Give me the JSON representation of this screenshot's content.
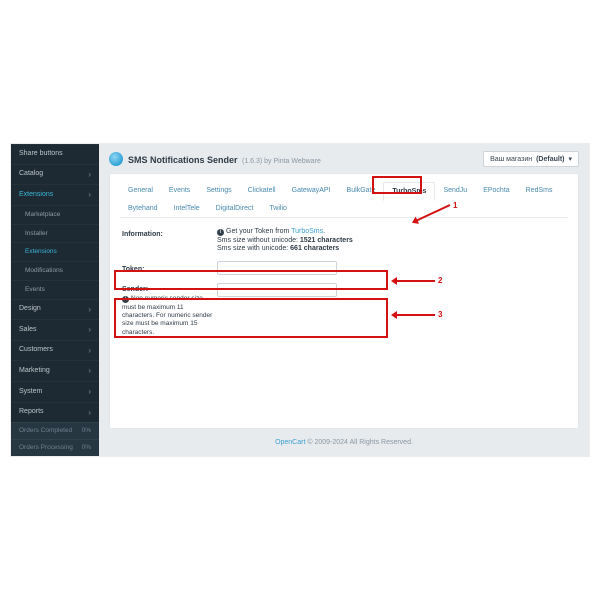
{
  "sidebar": {
    "items": [
      {
        "label": "Share buttons",
        "type": "item"
      },
      {
        "label": "Catalog",
        "type": "item",
        "chev": true
      },
      {
        "label": "Extensions",
        "type": "item",
        "chev": true,
        "active": true
      },
      {
        "label": "Marketplace",
        "type": "sub"
      },
      {
        "label": "Installer",
        "type": "sub"
      },
      {
        "label": "Extensions",
        "type": "sub",
        "selected": true
      },
      {
        "label": "Modifications",
        "type": "sub"
      },
      {
        "label": "Events",
        "type": "sub"
      },
      {
        "label": "Design",
        "type": "item",
        "chev": true
      },
      {
        "label": "Sales",
        "type": "item",
        "chev": true
      },
      {
        "label": "Customers",
        "type": "item",
        "chev": true
      },
      {
        "label": "Marketing",
        "type": "item",
        "chev": true
      },
      {
        "label": "System",
        "type": "item",
        "chev": true
      },
      {
        "label": "Reports",
        "type": "item",
        "chev": true
      }
    ],
    "footer": [
      {
        "label": "Orders Completed",
        "val": "0%"
      },
      {
        "label": "Orders Processing",
        "val": "0%"
      }
    ]
  },
  "header": {
    "title": "SMS Notifications Sender",
    "subtitle": "(1.6.3) by Pinta Webware",
    "store_label": "Ваш магазин",
    "store_value": "(Default)",
    "caret": "▾"
  },
  "tabs": [
    "General",
    "Events",
    "Settings",
    "Clickatell",
    "GatewayAPI",
    "BulkGate",
    "TurboSms",
    "SendJu",
    "EPochta",
    "RedSms",
    "Bytehand",
    "IntelTele",
    "DigitalDirect",
    "Twilio"
  ],
  "active_tab": "TurboSms",
  "info": {
    "label": "Information:",
    "line1_pre": "Get your Token from ",
    "line1_link": "TurboSms",
    "line1_post": ".",
    "line2_a": "Sms size without unicode: ",
    "line2_b": "1521 characters",
    "line3_a": "Sms size with unicode: ",
    "line3_b": "661 characters"
  },
  "token": {
    "label": "Token:"
  },
  "sender": {
    "label": "Sender:",
    "hint": "Non numeric sender size must be maximum 11 characters. For numeric sender size must be maximum 15 characters."
  },
  "markers": {
    "n1": "1",
    "n2": "2",
    "n3": "3"
  },
  "footer": {
    "link": "OpenCart",
    "rest": " © 2009-2024 All Rights Reserved."
  }
}
